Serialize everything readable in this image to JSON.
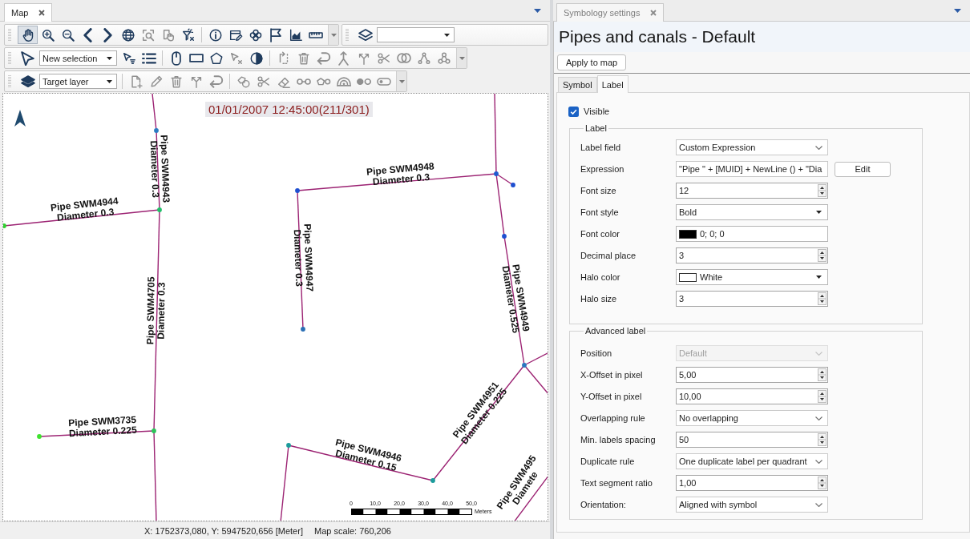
{
  "map_panel": {
    "tab": {
      "label": "Map",
      "focused": true
    },
    "toolbar_rows": [
      {
        "toolbars": [
          {
            "groups": [
              [
                {
                  "kind": "tool",
                  "selected": true,
                  "disabled": false
                },
                {
                  "kind": "tool",
                  "selected": false,
                  "disabled": false
                },
                {
                  "kind": "tool",
                  "selected": false,
                  "disabled": false
                },
                {
                  "kind": "tool",
                  "selected": false,
                  "disabled": false
                },
                {
                  "kind": "tool",
                  "selected": false,
                  "disabled": false
                },
                {
                  "kind": "tool",
                  "selected": false,
                  "disabled": false
                },
                {
                  "kind": "tool",
                  "selected": false,
                  "disabled": true
                },
                {
                  "kind": "tool",
                  "selected": false,
                  "disabled": true
                },
                {
                  "kind": "tool",
                  "selected": false,
                  "disabled": false
                }
              ],
              [
                {
                  "kind": "tool",
                  "selected": false,
                  "disabled": false
                },
                {
                  "kind": "tool",
                  "selected": false,
                  "disabled": false
                },
                {
                  "kind": "tool",
                  "selected": false,
                  "disabled": false
                },
                {
                  "kind": "tool",
                  "selected": false,
                  "disabled": false
                },
                {
                  "kind": "tool",
                  "selected": false,
                  "disabled": false
                },
                {
                  "kind": "tool",
                  "selected": false,
                  "disabled": false
                }
              ]
            ],
            "overflow": true
          },
          {
            "groups": [
              [
                {
                  "kind": "tool",
                  "selected": false,
                  "disabled": false
                },
                {
                  "kind": "combo"
                }
              ]
            ],
            "overflow": false
          }
        ]
      },
      {
        "toolbars": [
          {
            "groups": [
              [
                {
                  "kind": "tool",
                  "selected": false,
                  "disabled": false
                },
                {
                  "kind": "combo",
                  "value": "New selection"
                },
                {
                  "kind": "tool",
                  "selected": false,
                  "disabled": false
                },
                {
                  "kind": "tool",
                  "selected": false,
                  "disabled": false
                }
              ],
              [
                {
                  "kind": "tool",
                  "selected": false,
                  "disabled": false
                },
                {
                  "kind": "tool",
                  "selected": false,
                  "disabled": false
                },
                {
                  "kind": "tool",
                  "selected": false,
                  "disabled": false
                },
                {
                  "kind": "tool",
                  "selected": false,
                  "disabled": true
                },
                {
                  "kind": "tool",
                  "selected": false,
                  "disabled": false
                }
              ],
              [
                {
                  "kind": "tool",
                  "selected": false,
                  "disabled": true
                },
                {
                  "kind": "tool",
                  "selected": false,
                  "disabled": true
                },
                {
                  "kind": "tool",
                  "selected": false,
                  "disabled": true
                },
                {
                  "kind": "tool",
                  "selected": false,
                  "disabled": true
                },
                {
                  "kind": "tool",
                  "selected": false,
                  "disabled": true
                },
                {
                  "kind": "tool",
                  "selected": false,
                  "disabled": true
                },
                {
                  "kind": "tool",
                  "selected": false,
                  "disabled": true
                },
                {
                  "kind": "tool",
                  "selected": false,
                  "disabled": true
                },
                {
                  "kind": "tool",
                  "selected": false,
                  "disabled": true
                }
              ]
            ],
            "overflow": true
          }
        ]
      },
      {
        "toolbars": [
          {
            "groups": [
              [
                {
                  "kind": "tool",
                  "selected": false,
                  "disabled": false
                },
                {
                  "kind": "combo",
                  "value": "Target layer"
                }
              ],
              [
                {
                  "kind": "tool",
                  "selected": false,
                  "disabled": true
                },
                {
                  "kind": "tool",
                  "selected": false,
                  "disabled": true
                },
                {
                  "kind": "tool",
                  "selected": false,
                  "disabled": true
                },
                {
                  "kind": "tool",
                  "selected": false,
                  "disabled": true
                },
                {
                  "kind": "tool",
                  "selected": false,
                  "disabled": true
                }
              ],
              [
                {
                  "kind": "tool",
                  "selected": false,
                  "disabled": true
                },
                {
                  "kind": "tool",
                  "selected": false,
                  "disabled": true
                },
                {
                  "kind": "tool",
                  "selected": false,
                  "disabled": true
                },
                {
                  "kind": "tool",
                  "selected": false,
                  "disabled": true
                },
                {
                  "kind": "tool",
                  "selected": false,
                  "disabled": true
                },
                {
                  "kind": "tool",
                  "selected": false,
                  "disabled": true
                },
                {
                  "kind": "tool",
                  "selected": false,
                  "disabled": true
                },
                {
                  "kind": "tool",
                  "selected": false,
                  "disabled": true
                }
              ]
            ],
            "overflow": true
          }
        ]
      }
    ],
    "map": {
      "timestamp": "01/01/2007 12:45:00(211/301)",
      "pipe_labels": [
        {
          "lines": [
            "Pipe SWM4943",
            "Diameter 0.3"
          ]
        },
        {
          "lines": [
            "Pipe SWM4948",
            "Diameter 0.3"
          ]
        },
        {
          "lines": [
            "Pipe SWM4944",
            "Diameter 0.3"
          ]
        },
        {
          "lines": [
            "Pipe SWM4947",
            "Diameter 0.3"
          ]
        },
        {
          "lines": [
            "Pipe SWM4949",
            "Diameter 0.525"
          ]
        },
        {
          "lines": [
            "Pipe SWM4705",
            "Diameter 0.3"
          ]
        },
        {
          "lines": [
            "Pipe SWM4951",
            "Diameter 0.225"
          ]
        },
        {
          "lines": [
            "Pipe SWM3735",
            "Diameter 0.225"
          ]
        },
        {
          "lines": [
            "Pipe SWM4946",
            "Diameter 0.15"
          ]
        },
        {
          "lines": [
            "Pipe SWM495",
            "Diamete"
          ]
        }
      ],
      "scale_bar": {
        "ticks": [
          "0",
          "10,0",
          "20,0",
          "30,0",
          "40,0",
          "50,0"
        ],
        "unit": "Meters"
      }
    },
    "status_bar": {
      "coordinates": "X: 1752373,080, Y: 5947520,656 [Meter]",
      "map_scale": "Map scale: 760,206"
    }
  },
  "symbology_panel": {
    "tab": {
      "label": "Symbology settings",
      "focused": false
    },
    "title": "Pipes and canals - Default",
    "apply_button": "Apply to map",
    "tabs": [
      {
        "label": "Symbol",
        "selected": false
      },
      {
        "label": "Label",
        "selected": true
      }
    ],
    "visible": {
      "label": "Visible",
      "checked": true
    },
    "groups": [
      {
        "title": "Label",
        "rows": [
          {
            "label": "Label field",
            "kind": "combo",
            "value": "Custom Expression",
            "disabled": false
          },
          {
            "label": "Expression",
            "kind": "text",
            "value": "\"Pipe \" + [MUID] + NewLine () + \"Dia",
            "button": "Edit",
            "disabled": false
          },
          {
            "label": "Font size",
            "kind": "spin",
            "value": "12",
            "disabled": false
          },
          {
            "label": "Font style",
            "kind": "dropdown",
            "value": "Bold",
            "disabled": false
          },
          {
            "label": "Font color",
            "kind": "color",
            "value": "0; 0; 0",
            "color": "#000000",
            "disabled": false
          },
          {
            "label": "Decimal place",
            "kind": "spin",
            "value": "3",
            "disabled": false
          },
          {
            "label": "Halo color",
            "kind": "colorcombo",
            "value": "White",
            "color": "#ffffff",
            "disabled": false
          },
          {
            "label": "Halo size",
            "kind": "spin",
            "value": "3",
            "disabled": false
          }
        ]
      },
      {
        "title": "Advanced label",
        "rows": [
          {
            "label": "Position",
            "kind": "combo",
            "value": "Default",
            "disabled": true
          },
          {
            "label": "X-Offset in pixel",
            "kind": "spin",
            "value": "5,00",
            "disabled": false
          },
          {
            "label": "Y-Offset in pixel",
            "kind": "spin",
            "value": "10,00",
            "disabled": false
          },
          {
            "label": "Overlapping rule",
            "kind": "combo",
            "value": "No overlapping",
            "disabled": false
          },
          {
            "label": "Min. labels spacing",
            "kind": "spin",
            "value": "50",
            "disabled": false
          },
          {
            "label": "Duplicate rule",
            "kind": "combo",
            "value": "One duplicate label per quadrant",
            "disabled": false
          },
          {
            "label": "Text segment ratio",
            "kind": "spin",
            "value": "1,00",
            "disabled": false
          },
          {
            "label": "Orientation:",
            "kind": "combo",
            "value": "Aligned with symbol",
            "disabled": false
          }
        ]
      }
    ]
  }
}
